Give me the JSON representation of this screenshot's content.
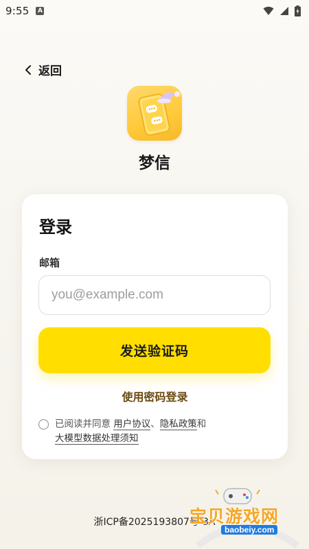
{
  "status_bar": {
    "time": "9:55",
    "app_icon_letter": "A",
    "icons": [
      "wifi-icon",
      "signal-icon",
      "battery-icon"
    ]
  },
  "nav": {
    "back_label": "返回",
    "back_icon": "chevron-left-icon"
  },
  "app": {
    "name": "梦信",
    "logo_icon": "chat-phone-logo"
  },
  "login_card": {
    "title": "登录",
    "email_label": "邮箱",
    "email_placeholder": "you@example.com",
    "email_value": "",
    "send_code_button": "发送验证码",
    "password_login_link": "使用密码登录",
    "agreement": {
      "checked": false,
      "prefix": "已阅读并同意 ",
      "link_user_agreement": "用户协议",
      "separator": "、",
      "link_privacy_policy": "隐私政策",
      "conjunction": "和",
      "link_model_notice": "大模型数据处理须知"
    }
  },
  "footer": {
    "icp": "浙ICP备2025193807号-3A"
  },
  "watermark": {
    "title": "宝贝游戏网",
    "url": "baobeiy.com"
  },
  "colors": {
    "accent": "#ffde00",
    "link_brown": "#6b4a10",
    "background": "#f7f5ef",
    "card": "#ffffff",
    "logo_yellow": "#ffc93a"
  }
}
